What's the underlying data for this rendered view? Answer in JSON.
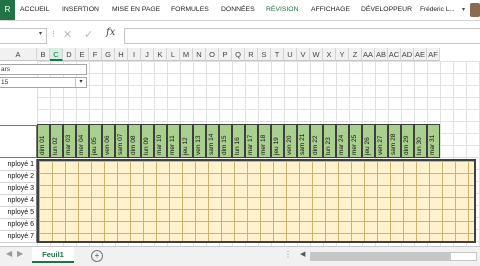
{
  "ribbon": {
    "file_tab": "R",
    "tabs": [
      "ACCUEIL",
      "INSERTION",
      "MISE EN PAGE",
      "FORMULES",
      "DONNÉES",
      "RÉVISION",
      "AFFICHAGE",
      "DÉVELOPPEUR"
    ],
    "active_tab": "RÉVISION",
    "user": "Fréderic L..."
  },
  "formula_bar": {
    "name_box": "",
    "formula": "",
    "fx_label": "fx"
  },
  "columns": [
    "A",
    "B",
    "C",
    "D",
    "E",
    "F",
    "G",
    "H",
    "I",
    "J",
    "K",
    "L",
    "M",
    "N",
    "O",
    "P",
    "Q",
    "R",
    "S",
    "T",
    "U",
    "V",
    "W",
    "X",
    "Y",
    "Z",
    "AA",
    "AB",
    "AC",
    "AD",
    "AE",
    "AF"
  ],
  "selected_column": "C",
  "controls": {
    "month_value": "ars",
    "year_value": "15"
  },
  "days": [
    "dim 01",
    "lun 02",
    "mar 03",
    "mer 04",
    "jeu 05",
    "ven 06",
    "sam 07",
    "dim 08",
    "lun 09",
    "mar 10",
    "mer 11",
    "jeu 12",
    "ven 13",
    "sam 14",
    "dim 15",
    "lun 16",
    "mar 17",
    "mer 18",
    "jeu 19",
    "ven 20",
    "sam 21",
    "dim 22",
    "lun 23",
    "mar 24",
    "mer 25",
    "jeu 26",
    "ven 27",
    "sam 28",
    "dim 29",
    "lun 30",
    "mar 31"
  ],
  "employees": [
    "nployé 1",
    "nployé 2",
    "nployé 3",
    "nployé 4",
    "nployé 5",
    "nployé 6",
    "nployé 7"
  ],
  "sheet_tabs": [
    "Feuil1"
  ],
  "colors": {
    "excel_green": "#217346",
    "header_fill": "#a9d08e",
    "body_fill": "#fff2cc"
  }
}
